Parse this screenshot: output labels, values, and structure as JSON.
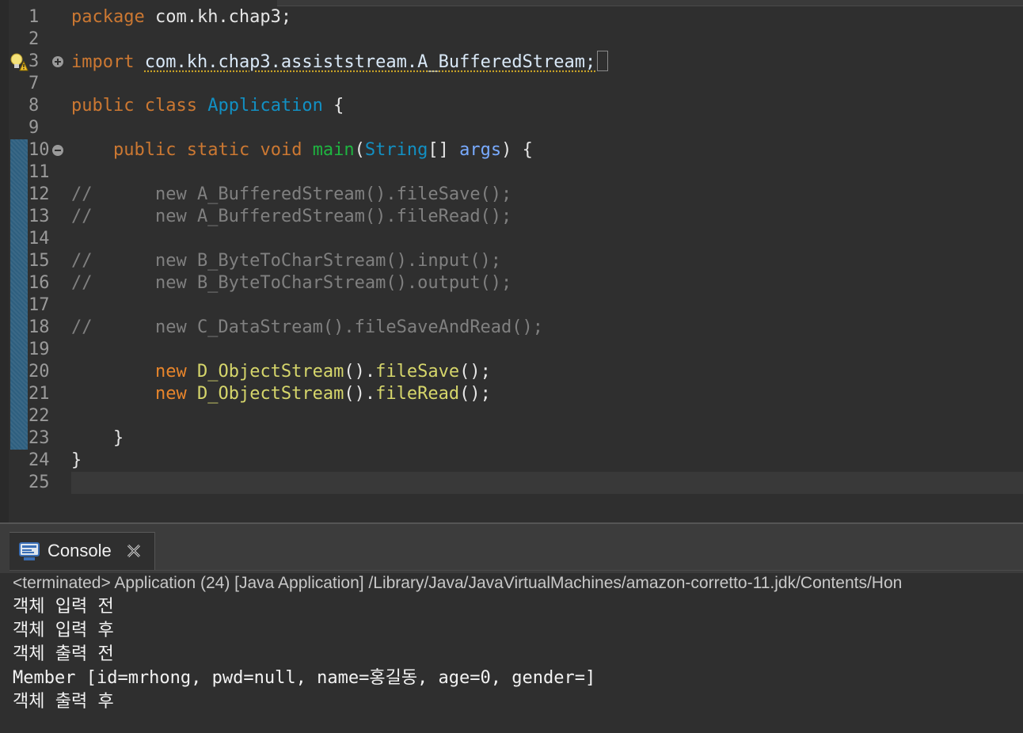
{
  "editor": {
    "lines": [
      {
        "n": "1",
        "t": [
          [
            "k",
            "package"
          ],
          [
            "plain",
            " com.kh.chap3;"
          ]
        ]
      },
      {
        "n": "2",
        "t": []
      },
      {
        "n": "3",
        "t": [
          [
            "k",
            "import"
          ],
          [
            "plain",
            " "
          ],
          [
            "imp",
            "com.kh.chap3.assiststream.A_BufferedStream;"
          ]
        ]
      },
      {
        "n": "7",
        "t": []
      },
      {
        "n": "8",
        "t": [
          [
            "k",
            "public"
          ],
          [
            "plain",
            " "
          ],
          [
            "k",
            "class"
          ],
          [
            "plain",
            " "
          ],
          [
            "cls",
            "Application"
          ],
          [
            "plain",
            " {"
          ]
        ]
      },
      {
        "n": "9",
        "t": []
      },
      {
        "n": "10",
        "t": [
          [
            "plain",
            "    "
          ],
          [
            "k",
            "public"
          ],
          [
            "plain",
            " "
          ],
          [
            "k",
            "static"
          ],
          [
            "plain",
            " "
          ],
          [
            "k",
            "void"
          ],
          [
            "plain",
            " "
          ],
          [
            "meth",
            "main"
          ],
          [
            "plain",
            "("
          ],
          [
            "cls",
            "String"
          ],
          [
            "plain",
            "[] "
          ],
          [
            "par",
            "args"
          ],
          [
            "plain",
            ") {"
          ]
        ]
      },
      {
        "n": "11",
        "t": []
      },
      {
        "n": "12",
        "t": [
          [
            "cmt",
            "//      new A_BufferedStream().fileSave();"
          ]
        ]
      },
      {
        "n": "13",
        "t": [
          [
            "cmt",
            "//      new A_BufferedStream().fileRead();"
          ]
        ]
      },
      {
        "n": "14",
        "t": []
      },
      {
        "n": "15",
        "t": [
          [
            "cmt",
            "//      new B_ByteToCharStream().input();"
          ]
        ]
      },
      {
        "n": "16",
        "t": [
          [
            "cmt",
            "//      new B_ByteToCharStream().output();"
          ]
        ]
      },
      {
        "n": "17",
        "t": []
      },
      {
        "n": "18",
        "t": [
          [
            "cmt",
            "//      new C_DataStream().fileSaveAndRead();"
          ]
        ]
      },
      {
        "n": "19",
        "t": []
      },
      {
        "n": "20",
        "t": [
          [
            "plain",
            "        "
          ],
          [
            "newk",
            "new"
          ],
          [
            "plain",
            " "
          ],
          [
            "ycls",
            "D_ObjectStream"
          ],
          [
            "plain",
            "()."
          ],
          [
            "ycls",
            "fileSave"
          ],
          [
            "plain",
            "();"
          ]
        ]
      },
      {
        "n": "21",
        "t": [
          [
            "plain",
            "        "
          ],
          [
            "newk",
            "new"
          ],
          [
            "plain",
            " "
          ],
          [
            "ycls",
            "D_ObjectStream"
          ],
          [
            "plain",
            "()."
          ],
          [
            "ycls",
            "fileRead"
          ],
          [
            "plain",
            "();"
          ]
        ]
      },
      {
        "n": "22",
        "t": []
      },
      {
        "n": "23",
        "t": [
          [
            "plain",
            "    }"
          ]
        ]
      },
      {
        "n": "24",
        "t": [
          [
            "plain",
            "}"
          ]
        ]
      },
      {
        "n": "25",
        "t": []
      }
    ]
  },
  "console": {
    "tab_label": "Console",
    "status": "<terminated> Application (24) [Java Application] /Library/Java/JavaVirtualMachines/amazon-corretto-11.jdk/Contents/Hon",
    "output": [
      "객체 입력 전",
      "객체 입력 후",
      "객체 출력 전",
      "Member [id=mrhong, pwd=null, name=홍길동, age=0, gender=]",
      "객체 출력 후"
    ]
  },
  "colors": {
    "keyword": "#cc7832",
    "class": "#1290c3",
    "method": "#1eb540",
    "comment": "#808080",
    "background": "#2f2f2f"
  }
}
